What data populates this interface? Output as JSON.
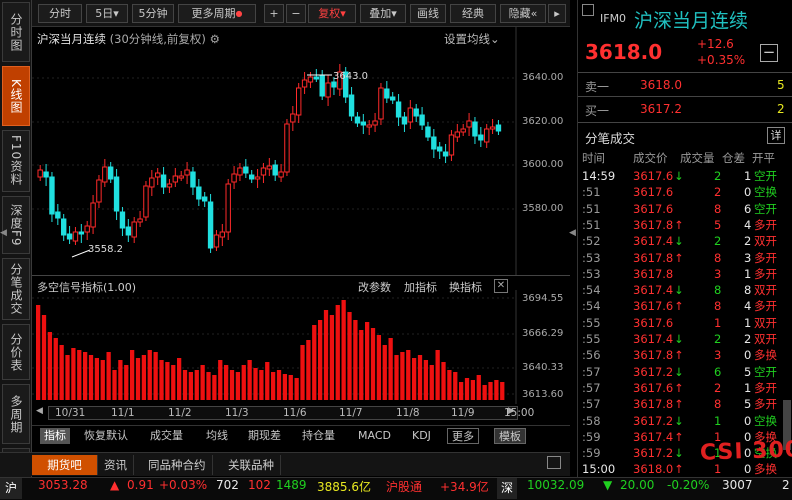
{
  "left_tabs": [
    {
      "label": "分时图",
      "active": false
    },
    {
      "label": "K线图",
      "active": true
    },
    {
      "label": "F10资料",
      "active": false
    },
    {
      "label": "深度F9",
      "active": false
    },
    {
      "label": "分笔成交",
      "active": false
    },
    {
      "label": "分价表",
      "active": false
    },
    {
      "label": "多周期",
      "active": false
    },
    {
      "label": "资",
      "active": false
    }
  ],
  "toolbar": {
    "fenshi": "分时",
    "day": "5日",
    "min5": "5分钟",
    "more_period": "更多周期",
    "plus": "+",
    "minus": "−",
    "fuquan": "复权",
    "overlay": "叠加",
    "draw_line": "画线",
    "classic": "经典",
    "hide": "隐藏"
  },
  "chart": {
    "title": "沪深当月连续",
    "subtitle": "(30分钟线,前复权)",
    "setting": "设置均线",
    "high_label": "3643.0",
    "low_label": "3558.2",
    "y_ticks": [
      "3640.00",
      "3620.00",
      "3600.00",
      "3580.00"
    ]
  },
  "indicator": {
    "title": "多空信号指标(1.00)",
    "modify": "改参数",
    "add": "加指标",
    "change": "换指标",
    "y_ticks": [
      "3694.55",
      "3666.29",
      "3640.33",
      "3613.60"
    ]
  },
  "x_axis": [
    "10/31",
    "11/1",
    "11/2",
    "11/3",
    "11/6",
    "11/7",
    "11/8",
    "11/9",
    "15:00"
  ],
  "bottom_tabs": [
    "指标",
    "恢复默认",
    "成交量",
    "均线",
    "期现差",
    "持仓量",
    "MACD",
    "KDJ",
    "更多",
    "模板"
  ],
  "lower_tabs": [
    "期货吧",
    "资讯",
    "同品种合约",
    "关联品种"
  ],
  "status": {
    "sh_label": "沪",
    "sh_value": "3053.28",
    "sh_arrow": "▲",
    "sh_chg": "0.91",
    "sh_pct": "+0.03%",
    "sh_vol": "702",
    "up": "102",
    "down": "1489",
    "amount": "3885.6亿",
    "hgt_label": "沪股通",
    "hgt_val": "+34.9亿",
    "sz_label": "深",
    "sz_value": "10032.09",
    "sz_arrow": "▼",
    "sz_chg": "20.00",
    "sz_pct": "-0.20%",
    "sz_vol": "3007",
    "sz_amt": "2"
  },
  "quote": {
    "code": "IFM0",
    "name": "沪深当月连续",
    "price": "3618.0",
    "change": "+12.6",
    "pct": "+0.35%",
    "sell_label": "卖一",
    "sell_price": "3618.0",
    "sell_vol": "5",
    "buy_label": "买一",
    "buy_price": "3617.2",
    "buy_vol": "2",
    "trades_title": "分笔成交",
    "detail_btn": "详",
    "headers": [
      "时间",
      "成交价",
      "成交量",
      "仓差",
      "开平"
    ]
  },
  "trades": [
    {
      "t": "14:59",
      "p": "3617.6",
      "a": "↓",
      "v": "2",
      "d": "1",
      "k": "空开"
    },
    {
      "t": ":51",
      "p": "3617.6",
      "a": "",
      "v": "2",
      "d": "0",
      "k": "空换"
    },
    {
      "t": ":51",
      "p": "3617.6",
      "a": "",
      "v": "8",
      "d": "6",
      "k": "空开"
    },
    {
      "t": ":51",
      "p": "3617.8",
      "a": "↑",
      "v": "5",
      "d": "4",
      "k": "多开"
    },
    {
      "t": ":52",
      "p": "3617.4",
      "a": "↓",
      "v": "2",
      "d": "2",
      "k": "双开"
    },
    {
      "t": ":53",
      "p": "3617.8",
      "a": "↑",
      "v": "8",
      "d": "3",
      "k": "多开"
    },
    {
      "t": ":53",
      "p": "3617.8",
      "a": "",
      "v": "3",
      "d": "1",
      "k": "多开"
    },
    {
      "t": ":54",
      "p": "3617.4",
      "a": "↓",
      "v": "8",
      "d": "8",
      "k": "双开"
    },
    {
      "t": ":54",
      "p": "3617.6",
      "a": "↑",
      "v": "8",
      "d": "4",
      "k": "多开"
    },
    {
      "t": ":55",
      "p": "3617.6",
      "a": "",
      "v": "1",
      "d": "1",
      "k": "双开"
    },
    {
      "t": ":55",
      "p": "3617.4",
      "a": "↓",
      "v": "2",
      "d": "2",
      "k": "双开"
    },
    {
      "t": ":56",
      "p": "3617.8",
      "a": "↑",
      "v": "3",
      "d": "0",
      "k": "多换"
    },
    {
      "t": ":57",
      "p": "3617.2",
      "a": "↓",
      "v": "6",
      "d": "5",
      "k": "空开"
    },
    {
      "t": ":57",
      "p": "3617.6",
      "a": "↑",
      "v": "2",
      "d": "1",
      "k": "多开"
    },
    {
      "t": ":57",
      "p": "3617.8",
      "a": "↑",
      "v": "8",
      "d": "5",
      "k": "多开"
    },
    {
      "t": ":58",
      "p": "3617.2",
      "a": "↓",
      "v": "1",
      "d": "0",
      "k": "空换"
    },
    {
      "t": ":59",
      "p": "3617.4",
      "a": "↑",
      "v": "1",
      "d": "0",
      "k": "多换"
    },
    {
      "t": ":59",
      "p": "3617.2",
      "a": "↓",
      "v": "1",
      "d": "0",
      "k": "空换"
    },
    {
      "t": "15:00",
      "p": "3618.0",
      "a": "↑",
      "v": "1",
      "d": "0",
      "k": "多换"
    }
  ],
  "logo": "CSI 300"
}
